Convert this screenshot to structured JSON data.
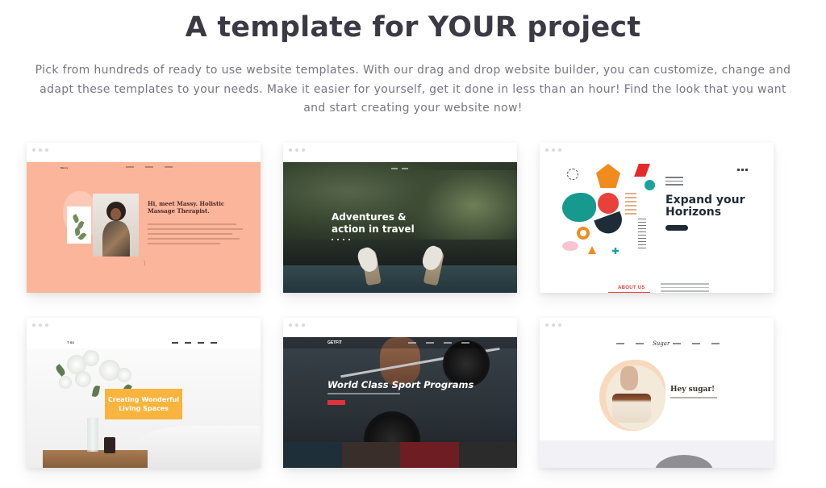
{
  "header": {
    "title": "A template for YOUR project",
    "description": "Pick from hundreds of ready to use website templates. With our drag and drop website builder, you can customize, change and adapt these templates to your needs. Make it easier for yourself, get it done in less than an hour! Find the look that you want and start creating your website now!"
  },
  "templates": [
    {
      "name": "Massy",
      "logo": "Massy",
      "headline": "Hi, meet Massy. Holistic Massage Therapist."
    },
    {
      "name": "Adventures",
      "headline": "Adventures & action in travel"
    },
    {
      "name": "Horizons",
      "headline": "Expand your Horizons",
      "section_label": "ABOUT US"
    },
    {
      "name": "Living Spaces",
      "logo": "T·S3",
      "headline": "Creating Wonderful Living Spaces"
    },
    {
      "name": "Sport",
      "logo": "GETFIT",
      "headline": "World Class Sport Programs"
    },
    {
      "name": "Sugar",
      "logo": "Sugar",
      "headline": "Hey sugar!"
    }
  ],
  "colors": {
    "heading": "#3b3a44",
    "body_text": "#77767f",
    "massy_bg": "#fab59a",
    "horizons_accent": "#e8443f",
    "living_label": "#f9b43e",
    "sport_button": "#e0323a"
  }
}
